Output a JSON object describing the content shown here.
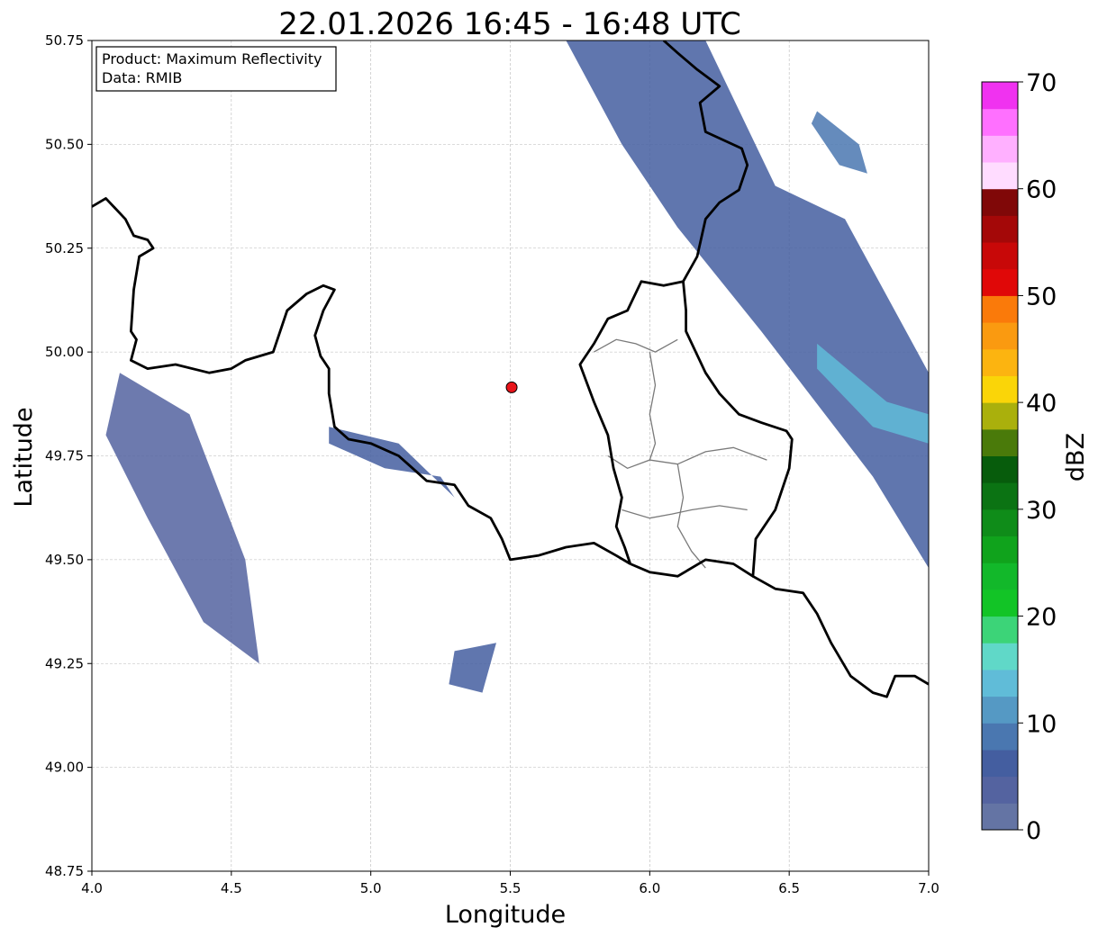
{
  "figure": {
    "title": "22.01.2026 16:45 - 16:48 UTC",
    "product_line": "Product: Maximum Reflectivity",
    "data_line": "Data: RMIB"
  },
  "map": {
    "xlabel": "Longitude",
    "ylabel": "Latitude",
    "xlim": [
      4.0,
      7.0
    ],
    "ylim": [
      48.75,
      50.75
    ],
    "x_ticks": [
      "4.0",
      "4.5",
      "5.0",
      "5.5",
      "6.0",
      "6.5",
      "7.0"
    ],
    "y_ticks": [
      "48.75",
      "49.00",
      "49.25",
      "49.50",
      "49.75",
      "50.00",
      "50.25",
      "50.50",
      "50.75"
    ],
    "grid": true,
    "radar_site": {
      "lon": 5.505,
      "lat": 49.915,
      "color": "#e8141a"
    },
    "echo_regions": [
      {
        "name": "northeast-band",
        "dbz": 6,
        "points": [
          [
            5.7,
            50.75
          ],
          [
            6.2,
            50.75
          ],
          [
            6.45,
            50.4
          ],
          [
            6.7,
            50.32
          ],
          [
            7.0,
            49.95
          ],
          [
            7.0,
            49.48
          ],
          [
            6.8,
            49.7
          ],
          [
            6.4,
            50.05
          ],
          [
            6.1,
            50.3
          ],
          [
            5.9,
            50.5
          ]
        ]
      },
      {
        "name": "northeast-core",
        "dbz": 14,
        "points": [
          [
            6.6,
            50.02
          ],
          [
            6.85,
            49.88
          ],
          [
            7.0,
            49.85
          ],
          [
            7.0,
            49.78
          ],
          [
            6.8,
            49.82
          ],
          [
            6.6,
            49.96
          ]
        ]
      },
      {
        "name": "ne-small-cell",
        "dbz": 8,
        "points": [
          [
            6.6,
            50.58
          ],
          [
            6.75,
            50.5
          ],
          [
            6.78,
            50.43
          ],
          [
            6.68,
            50.45
          ],
          [
            6.58,
            50.55
          ]
        ]
      },
      {
        "name": "west-scatter",
        "dbz": 4,
        "points": [
          [
            4.1,
            49.95
          ],
          [
            4.35,
            49.85
          ],
          [
            4.55,
            49.5
          ],
          [
            4.6,
            49.25
          ],
          [
            4.4,
            49.35
          ],
          [
            4.2,
            49.6
          ],
          [
            4.05,
            49.8
          ]
        ]
      },
      {
        "name": "south-scatter",
        "dbz": 5,
        "points": [
          [
            5.3,
            49.28
          ],
          [
            5.45,
            49.3
          ],
          [
            5.4,
            49.18
          ],
          [
            5.28,
            49.2
          ]
        ]
      },
      {
        "name": "border-band",
        "dbz": 5,
        "points": [
          [
            4.85,
            49.82
          ],
          [
            5.1,
            49.78
          ],
          [
            5.3,
            49.65
          ],
          [
            5.25,
            49.7
          ],
          [
            5.05,
            49.72
          ],
          [
            4.85,
            49.78
          ]
        ]
      }
    ],
    "borders": [
      {
        "name": "france-belgium-border",
        "points": [
          [
            4.0,
            50.35
          ],
          [
            4.05,
            50.37
          ],
          [
            4.12,
            50.32
          ],
          [
            4.15,
            50.28
          ],
          [
            4.2,
            50.27
          ],
          [
            4.22,
            50.25
          ],
          [
            4.17,
            50.23
          ],
          [
            4.15,
            50.15
          ],
          [
            4.14,
            50.05
          ],
          [
            4.16,
            50.03
          ],
          [
            4.14,
            49.98
          ],
          [
            4.2,
            49.96
          ],
          [
            4.3,
            49.97
          ],
          [
            4.42,
            49.95
          ],
          [
            4.5,
            49.96
          ],
          [
            4.55,
            49.98
          ],
          [
            4.65,
            50.0
          ],
          [
            4.7,
            50.1
          ],
          [
            4.77,
            50.14
          ],
          [
            4.83,
            50.16
          ],
          [
            4.87,
            50.15
          ],
          [
            4.83,
            50.1
          ],
          [
            4.8,
            50.04
          ],
          [
            4.82,
            49.99
          ],
          [
            4.85,
            49.96
          ],
          [
            4.85,
            49.9
          ],
          [
            4.87,
            49.82
          ],
          [
            4.92,
            49.79
          ],
          [
            5.0,
            49.78
          ],
          [
            5.1,
            49.75
          ],
          [
            5.15,
            49.72
          ],
          [
            5.2,
            49.69
          ],
          [
            5.3,
            49.68
          ],
          [
            5.35,
            49.63
          ],
          [
            5.43,
            49.6
          ],
          [
            5.47,
            49.55
          ],
          [
            5.5,
            49.5
          ],
          [
            5.6,
            49.51
          ],
          [
            5.7,
            49.53
          ],
          [
            5.8,
            49.54
          ],
          [
            5.88,
            49.51
          ],
          [
            5.93,
            49.49
          ]
        ]
      },
      {
        "name": "luxembourg-border",
        "points": [
          [
            5.93,
            49.49
          ],
          [
            6.0,
            49.47
          ],
          [
            6.1,
            49.46
          ],
          [
            6.2,
            49.5
          ],
          [
            6.3,
            49.49
          ],
          [
            6.37,
            49.46
          ],
          [
            6.38,
            49.55
          ],
          [
            6.45,
            49.62
          ],
          [
            6.5,
            49.72
          ],
          [
            6.51,
            49.79
          ],
          [
            6.49,
            49.81
          ],
          [
            6.4,
            49.83
          ],
          [
            6.32,
            49.85
          ],
          [
            6.25,
            49.9
          ],
          [
            6.2,
            49.95
          ],
          [
            6.13,
            50.05
          ],
          [
            6.13,
            50.1
          ],
          [
            6.12,
            50.17
          ],
          [
            6.05,
            50.16
          ],
          [
            5.97,
            50.17
          ],
          [
            5.92,
            50.1
          ],
          [
            5.85,
            50.08
          ],
          [
            5.8,
            50.02
          ],
          [
            5.75,
            49.97
          ],
          [
            5.8,
            49.88
          ],
          [
            5.85,
            49.8
          ],
          [
            5.87,
            49.72
          ],
          [
            5.9,
            49.65
          ],
          [
            5.88,
            49.58
          ],
          [
            5.91,
            49.53
          ],
          [
            5.93,
            49.49
          ]
        ]
      },
      {
        "name": "belgium-germany-border",
        "points": [
          [
            6.12,
            50.17
          ],
          [
            6.17,
            50.23
          ],
          [
            6.2,
            50.32
          ],
          [
            6.25,
            50.36
          ],
          [
            6.32,
            50.39
          ],
          [
            6.35,
            50.45
          ],
          [
            6.33,
            50.49
          ],
          [
            6.2,
            50.53
          ],
          [
            6.18,
            50.6
          ],
          [
            6.25,
            50.64
          ],
          [
            6.17,
            50.68
          ],
          [
            6.1,
            50.72
          ],
          [
            6.05,
            50.75
          ]
        ]
      },
      {
        "name": "france-germany-border",
        "points": [
          [
            6.37,
            49.46
          ],
          [
            6.45,
            49.43
          ],
          [
            6.55,
            49.42
          ],
          [
            6.6,
            49.37
          ],
          [
            6.65,
            49.3
          ],
          [
            6.72,
            49.22
          ],
          [
            6.8,
            49.18
          ],
          [
            6.85,
            49.17
          ],
          [
            6.88,
            49.22
          ],
          [
            6.95,
            49.22
          ],
          [
            7.0,
            49.2
          ]
        ]
      }
    ],
    "internal_borders": [
      {
        "name": "lux-district-north",
        "points": [
          [
            5.8,
            50.0
          ],
          [
            5.88,
            50.03
          ],
          [
            5.95,
            50.02
          ],
          [
            6.02,
            50.0
          ],
          [
            6.1,
            50.03
          ]
        ]
      },
      {
        "name": "lux-district-center",
        "points": [
          [
            5.85,
            49.75
          ],
          [
            5.92,
            49.72
          ],
          [
            6.0,
            49.74
          ],
          [
            6.1,
            49.73
          ],
          [
            6.2,
            49.76
          ],
          [
            6.3,
            49.77
          ],
          [
            6.42,
            49.74
          ]
        ]
      },
      {
        "name": "lux-district-south",
        "points": [
          [
            5.9,
            49.62
          ],
          [
            6.0,
            49.6
          ],
          [
            6.08,
            49.61
          ],
          [
            6.15,
            49.62
          ],
          [
            6.25,
            49.63
          ],
          [
            6.35,
            49.62
          ]
        ]
      },
      {
        "name": "lux-district-north-south",
        "points": [
          [
            6.0,
            50.0
          ],
          [
            6.02,
            49.92
          ],
          [
            6.0,
            49.85
          ],
          [
            6.02,
            49.78
          ],
          [
            6.0,
            49.74
          ]
        ]
      },
      {
        "name": "lux-district-center-south",
        "points": [
          [
            6.1,
            49.73
          ],
          [
            6.12,
            49.65
          ],
          [
            6.1,
            49.58
          ],
          [
            6.15,
            49.52
          ],
          [
            6.2,
            49.48
          ]
        ]
      }
    ]
  },
  "colorbar": {
    "label": "dBZ",
    "range": [
      0,
      70
    ],
    "ticks": [
      "0",
      "10",
      "20",
      "30",
      "40",
      "50",
      "60",
      "70"
    ],
    "colors": [
      "#6474a4",
      "#5463a0",
      "#445ea0",
      "#4a77b0",
      "#5599c4",
      "#60bcd8",
      "#60d8c8",
      "#3cd478",
      "#12c426",
      "#12b82a",
      "#10a31c",
      "#0f8c19",
      "#0b7313",
      "#075c0c",
      "#4a7a0a",
      "#aab00c",
      "#fad508",
      "#fcb410",
      "#fa9a10",
      "#fa7a0a",
      "#e00808",
      "#c80808",
      "#a40808",
      "#800808",
      "#ffdcff",
      "#ffb0ff",
      "#ff70ff",
      "#f032f0"
    ]
  }
}
